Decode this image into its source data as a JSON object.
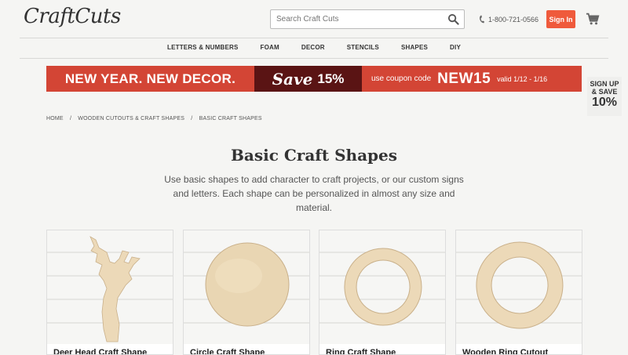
{
  "header": {
    "logo": "CraftCuts",
    "search_placeholder": "Search Craft Cuts",
    "phone": "1-800-721-0566",
    "signin_label": "Sign In"
  },
  "nav": [
    "LETTERS & NUMBERS",
    "FOAM",
    "DECOR",
    "STENCILS",
    "SHAPES",
    "DIY"
  ],
  "promo": {
    "headline": "NEW YEAR. NEW DECOR.",
    "save_word": "Save",
    "save_pct": "15%",
    "coupon_text": "use coupon code",
    "code": "NEW15",
    "valid": "valid 1/12 - 1/16"
  },
  "signup": {
    "line1": "SIGN UP",
    "line2": "& SAVE",
    "line3": "10%"
  },
  "breadcrumb": [
    "HOME",
    "WOODEN CUTOUTS & CRAFT SHAPES",
    "BASIC CRAFT SHAPES"
  ],
  "page": {
    "title": "Basic Craft Shapes",
    "description": "Use basic shapes to add character to craft projects, or our custom signs and letters. Each shape can be personalized in almost any size and material."
  },
  "products": [
    {
      "name": "Deer Head Craft Shape",
      "icon": "deer-head"
    },
    {
      "name": "Circle Craft Shape",
      "icon": "circle"
    },
    {
      "name": "Ring Craft Shape",
      "icon": "ring"
    },
    {
      "name": "Wooden Ring Cutout",
      "icon": "ring-wide"
    }
  ],
  "colors": {
    "accent": "#ef5a3c",
    "banner_red": "#d34535",
    "banner_dark": "#5a1414",
    "wood": "#ecd9b8"
  }
}
